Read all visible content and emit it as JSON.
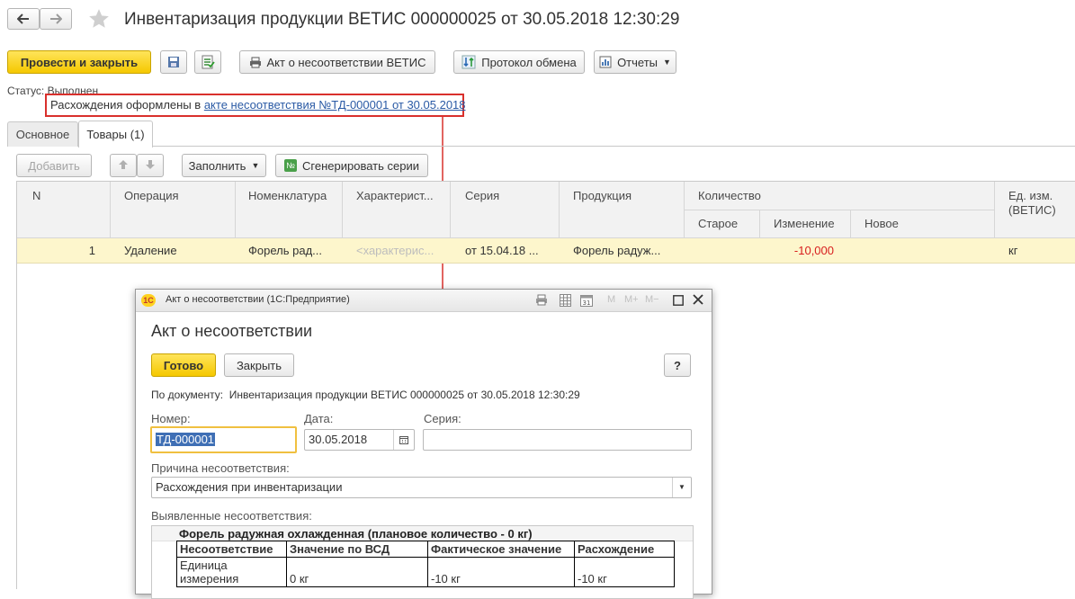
{
  "nav": {
    "back_icon": "arrow-left-icon",
    "forward_icon": "arrow-right-icon",
    "favorite_icon": "star-icon"
  },
  "window": {
    "title": "Инвентаризация продукции ВЕТИС 000000025 от 30.05.2018 12:30:29"
  },
  "toolbar": {
    "post_close_label": "Провести и закрыть",
    "act_label": "Акт о несоответствии ВЕТИС",
    "protocol_label": "Протокол обмена",
    "reports_label": "Отчеты"
  },
  "status": {
    "text": "Статус: Выполнен",
    "discrepancy_prefix": "Расхождения оформлены в",
    "discrepancy_link": "акте несоответствия №ТД-000001 от 30.05.2018"
  },
  "tabs": [
    {
      "label": "Основное"
    },
    {
      "label": "Товары (1)"
    }
  ],
  "table_toolbar": {
    "add_label": "Добавить",
    "fill_label": "Заполнить",
    "generate_label": "Сгенерировать серии"
  },
  "table": {
    "headers": {
      "n": "N",
      "operation": "Операция",
      "nomenclature": "Номенклатура",
      "characteristic": "Характерист...",
      "series": "Серия",
      "product": "Продукция",
      "quantity": "Количество",
      "old": "Старое",
      "change": "Изменение",
      "new": "Новое",
      "unit": "Ед. изм. (ВЕТИС)"
    },
    "rows": [
      {
        "n": "1",
        "operation": "Удаление",
        "nomenclature": "Форель рад...",
        "characteristic": "<характерис...",
        "series": "от 15.04.18 ...",
        "product": "Форель радуж...",
        "old": "",
        "change": "-10,000",
        "new": "",
        "unit": "кг"
      }
    ]
  },
  "dialog": {
    "titlebar": "Акт о несоответствии  (1С:Предприятие)",
    "logo_text": "1С",
    "heading": "Акт о несоответствии",
    "ready_label": "Готово",
    "close_label": "Закрыть",
    "help_label": "?",
    "by_document": "По документу:  Инвентаризация продукции ВЕТИС 000000025 от 30.05.2018 12:30:29",
    "number_label": "Номер:",
    "number_value": "ТД-000001",
    "date_label": "Дата:",
    "date_value": "30.05.2018",
    "series_label": "Серия:",
    "series_value": "",
    "reason_label": "Причина несоответствия:",
    "reason_value": "Расхождения при инвентаризации",
    "found_label": "Выявленные несоответствия:",
    "block_title": "Форель радужная охлажденная (плановое количество - 0 кг)",
    "disc_headers": [
      "Несоответствие",
      "Значение по ВСД",
      "Фактическое значение",
      "Расхождение"
    ],
    "disc_rows": [
      [
        "Единица измерения",
        "0 кг",
        "-10 кг",
        "-10 кг"
      ]
    ],
    "title_icons": [
      "print-icon",
      "table-icon",
      "calendar-icon",
      "m-icon",
      "m-plus-icon",
      "m-minus-icon",
      "maximize-icon",
      "close-icon"
    ],
    "memory": {
      "m": "M",
      "mplus": "M+",
      "mminus": "M−"
    }
  },
  "colors": {
    "highlight": "#fdf6cc",
    "annotation": "#d9302c",
    "link": "#2a5aa5",
    "negative": "#d81e1e"
  }
}
